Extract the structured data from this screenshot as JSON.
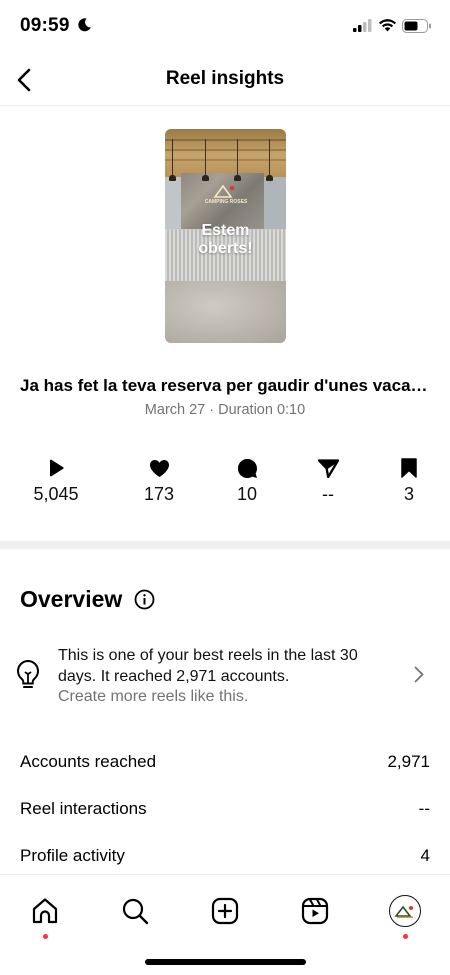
{
  "status_bar": {
    "time": "09:59"
  },
  "header": {
    "title": "Reel insights"
  },
  "reel": {
    "overlay_line1": "Estem",
    "overlay_line2": "oberts!",
    "logo_text": "CAMPING ROSES",
    "caption": "Ja has fet la teva reserva per gaudir d'unes vacances",
    "meta": "March 27 · Duration 0:10"
  },
  "stats": [
    {
      "icon": "play-icon",
      "value": "5,045"
    },
    {
      "icon": "heart-icon",
      "value": "173"
    },
    {
      "icon": "comment-icon",
      "value": "10"
    },
    {
      "icon": "share-icon",
      "value": "--"
    },
    {
      "icon": "bookmark-icon",
      "value": "3"
    }
  ],
  "overview": {
    "title": "Overview",
    "tip_line": "This is one of your best reels in the last 30 days. It reached 2,971 accounts.",
    "tip_sub": "Create more reels like this.",
    "rows": [
      {
        "label": "Accounts reached",
        "value": "2,971"
      },
      {
        "label": "Reel interactions",
        "value": "--"
      },
      {
        "label": "Profile activity",
        "value": "4"
      }
    ]
  },
  "nav": {
    "items": [
      "home-icon",
      "search-icon",
      "create-icon",
      "reels-icon",
      "profile-avatar"
    ]
  },
  "colors": {
    "notification_dot": "#ff3040",
    "secondary_text": "#737373"
  }
}
